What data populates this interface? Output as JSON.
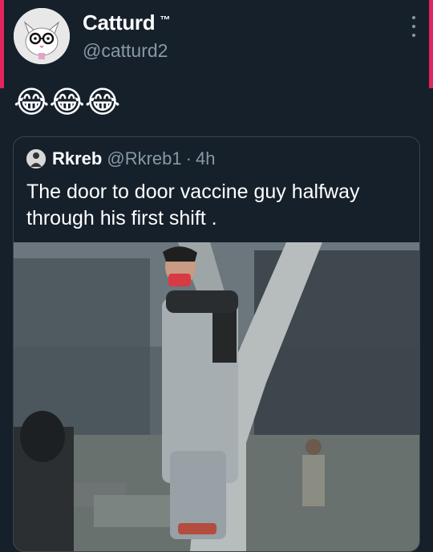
{
  "tweet": {
    "author_name": "Catturd",
    "author_mark": "™",
    "author_handle": "@catturd2",
    "more_icon": "more-vertical-icon",
    "text": "😂😂😂"
  },
  "quoted_tweet": {
    "author_name": "Rkreb",
    "author_handle": "@Rkreb1",
    "separator": "·",
    "time": "4h",
    "text": "The door to door vaccine guy halfway through his first shift .",
    "photo_icon": "tweet-photo"
  },
  "colors": {
    "background": "#15202b",
    "border": "#38444d",
    "muted_text": "#8899a6",
    "accent_edge": "#e0245e"
  }
}
